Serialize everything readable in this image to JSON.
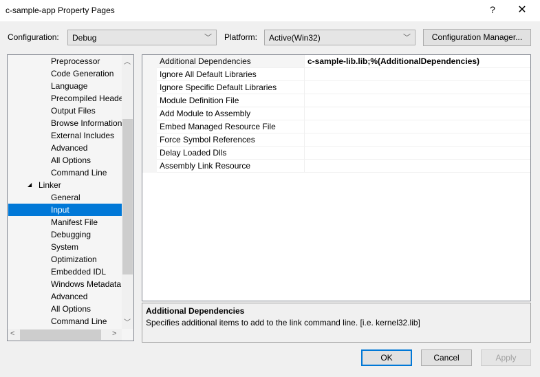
{
  "window": {
    "title": "c-sample-app Property Pages",
    "help": "?",
    "close": "✕"
  },
  "config": {
    "configuration_label": "Configuration:",
    "configuration_value": "Debug",
    "platform_label": "Platform:",
    "platform_value": "Active(Win32)",
    "manager_button": "Configuration Manager..."
  },
  "tree": {
    "items": [
      {
        "label": "Preprocessor"
      },
      {
        "label": "Code Generation"
      },
      {
        "label": "Language"
      },
      {
        "label": "Precompiled Heade"
      },
      {
        "label": "Output Files"
      },
      {
        "label": "Browse Information"
      },
      {
        "label": "External Includes"
      },
      {
        "label": "Advanced"
      },
      {
        "label": "All Options"
      },
      {
        "label": "Command Line"
      },
      {
        "label": "Linker",
        "expanded": true
      },
      {
        "label": "General"
      },
      {
        "label": "Input",
        "selected": true
      },
      {
        "label": "Manifest File"
      },
      {
        "label": "Debugging"
      },
      {
        "label": "System"
      },
      {
        "label": "Optimization"
      },
      {
        "label": "Embedded IDL"
      },
      {
        "label": "Windows Metadata"
      },
      {
        "label": "Advanced"
      },
      {
        "label": "All Options"
      },
      {
        "label": "Command Line"
      }
    ]
  },
  "grid": {
    "rows": [
      {
        "name": "Additional Dependencies",
        "value": "c-sample-lib.lib;%(AdditionalDependencies)"
      },
      {
        "name": "Ignore All Default Libraries",
        "value": ""
      },
      {
        "name": "Ignore Specific Default Libraries",
        "value": ""
      },
      {
        "name": "Module Definition File",
        "value": ""
      },
      {
        "name": "Add Module to Assembly",
        "value": ""
      },
      {
        "name": "Embed Managed Resource File",
        "value": ""
      },
      {
        "name": "Force Symbol References",
        "value": ""
      },
      {
        "name": "Delay Loaded Dlls",
        "value": ""
      },
      {
        "name": "Assembly Link Resource",
        "value": ""
      }
    ]
  },
  "description": {
    "title": "Additional Dependencies",
    "text": "Specifies additional items to add to the link command line. [i.e. kernel32.lib]"
  },
  "buttons": {
    "ok": "OK",
    "cancel": "Cancel",
    "apply": "Apply"
  },
  "colors": {
    "selection": "#0078d7",
    "focus_border": "#0078d7"
  }
}
